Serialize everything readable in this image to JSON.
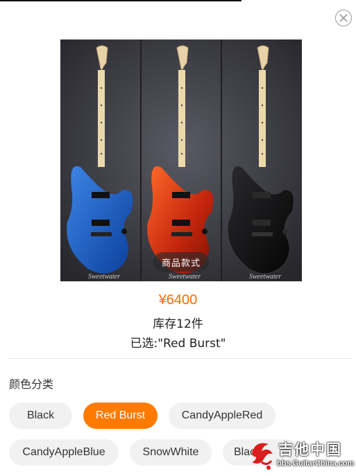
{
  "product": {
    "image_tag": "商品款式",
    "image_brand_text": "Sweetwater",
    "price": "¥6400",
    "stock": "库存12件",
    "selected": "已选:\"Red Burst\""
  },
  "color_section": {
    "title": "颜色分类",
    "options": [
      {
        "label": "Black",
        "active": false
      },
      {
        "label": "Red Burst",
        "active": true
      },
      {
        "label": "CandyAppleRed",
        "active": false
      },
      {
        "label": "CandyAppleBlue",
        "active": false
      },
      {
        "label": "SnowWhite",
        "active": false
      },
      {
        "label": "Black",
        "active": false
      }
    ]
  },
  "watermark": {
    "title": "吉他中国",
    "url": "bbs.GuitarChina.com"
  },
  "colors": {
    "accent": "#ff6a00",
    "active_chip": "#ff7a00",
    "chip_bg": "#f1f1f1",
    "watermark_red": "#d81e1e"
  },
  "icons": {
    "close": "close-icon"
  }
}
